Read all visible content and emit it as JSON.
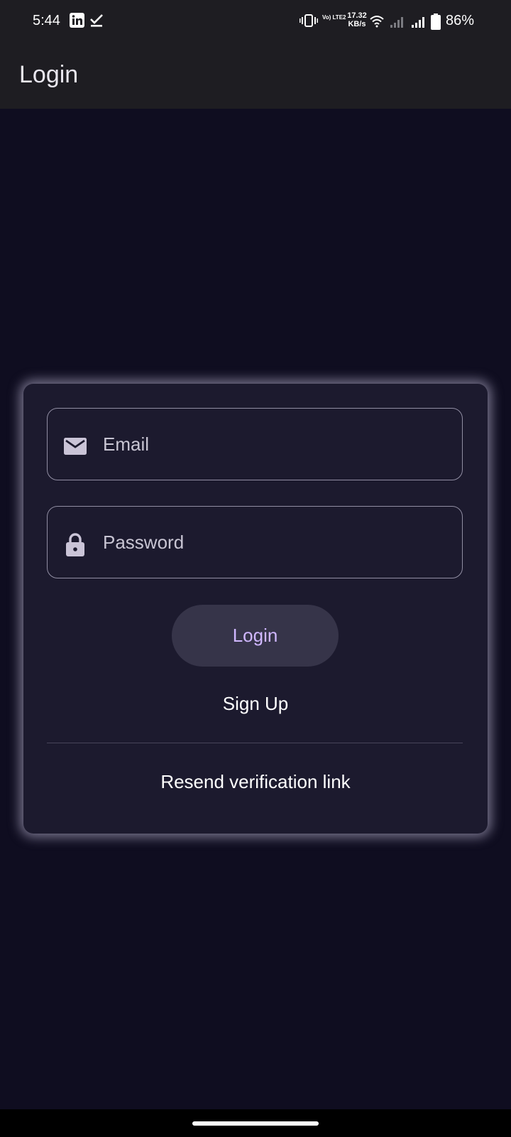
{
  "status_bar": {
    "time": "5:44",
    "volte_label": "Vo) LTE2",
    "net_speed_value": "17.32",
    "net_speed_unit": "KB/s",
    "battery_percent": "86%",
    "icons": [
      "linkedin-icon",
      "checkmark-icon",
      "vibrate-icon",
      "wifi-icon",
      "signal-icon",
      "battery-icon"
    ]
  },
  "app_bar": {
    "title": "Login"
  },
  "login_form": {
    "email_placeholder": "Email",
    "password_placeholder": "Password",
    "login_label": "Login",
    "signup_label": "Sign Up",
    "resend_label": "Resend verification link"
  },
  "colors": {
    "background": "#0f0d20",
    "card": "#1c1a2e",
    "app_bar": "#1e1d22",
    "accent": "#d0b7ff",
    "button": "#363449"
  }
}
